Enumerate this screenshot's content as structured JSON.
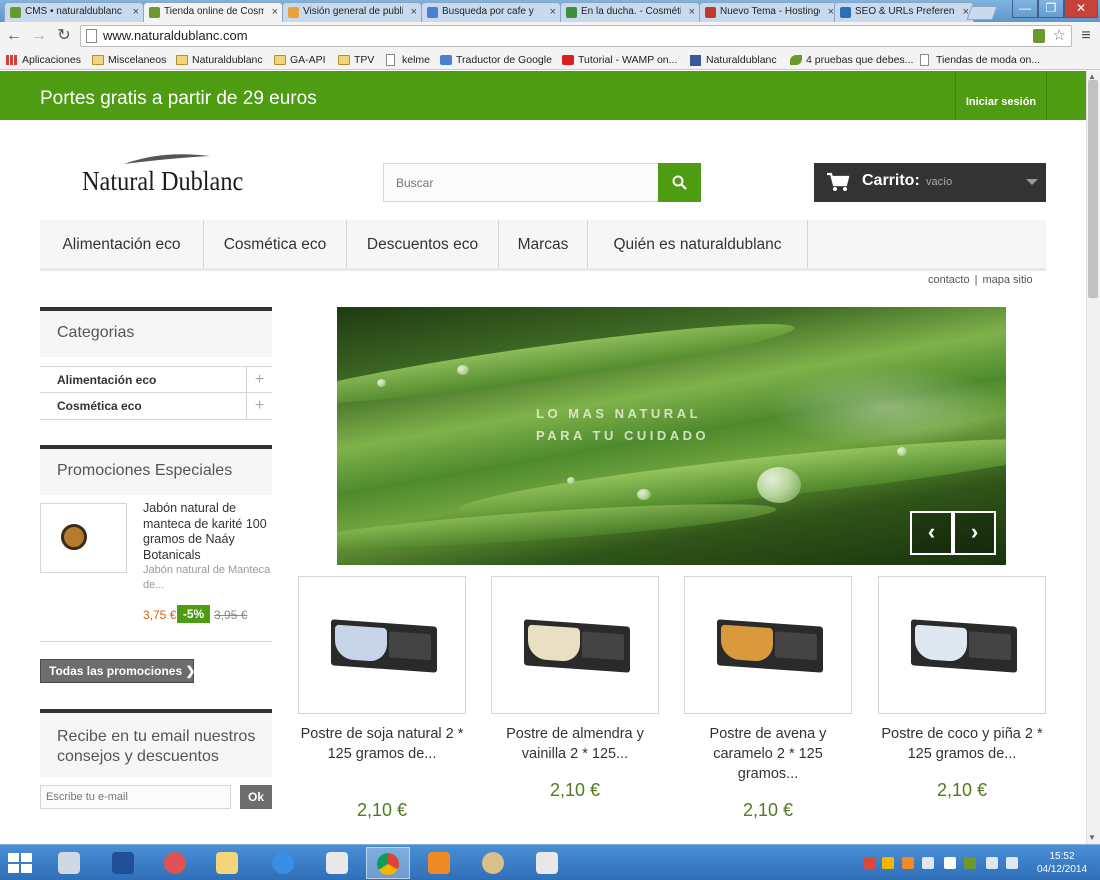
{
  "browser": {
    "tabs": [
      {
        "title": "CMS • naturaldublanc",
        "favicon_color": "#6a9a2e",
        "active": false
      },
      {
        "title": "Tienda online de Cosmética",
        "favicon_color": "#6a9a2e",
        "active": true
      },
      {
        "title": "Visión general de publicidad",
        "favicon_color": "#e8a33d",
        "active": false
      },
      {
        "title": "Busqueda por cafe y",
        "favicon_color": "#4a7fd4",
        "active": false
      },
      {
        "title": "En la ducha. - Cosmética",
        "favicon_color": "#3f8f3f",
        "active": false
      },
      {
        "title": "Nuevo Tema - Hostinger",
        "favicon_color": "#c0392b",
        "active": false
      },
      {
        "title": "SEO & URLs Preferencias",
        "favicon_color": "#2a6fb8",
        "active": false
      }
    ],
    "close_glyph": "×",
    "url": "www.naturaldublanc.com",
    "nav": {
      "back": "←",
      "forward": "→",
      "reload": "↻",
      "menu": "≡",
      "star": "☆"
    },
    "window_controls": {
      "minimize": "—",
      "maximize": "❐",
      "close": "✕"
    },
    "bookmarks": [
      {
        "label": "Aplicaciones",
        "icon": "apps-icon"
      },
      {
        "label": "Miscelaneos",
        "icon": "folder-icon"
      },
      {
        "label": "Naturaldublanc",
        "icon": "folder-icon"
      },
      {
        "label": "GA-API",
        "icon": "folder-icon"
      },
      {
        "label": "TPV",
        "icon": "folder-icon"
      },
      {
        "label": "kelme",
        "icon": "page-icon"
      },
      {
        "label": "Traductor de Google",
        "icon": "translate-icon"
      },
      {
        "label": "Tutorial - WAMP on...",
        "icon": "youtube-icon"
      },
      {
        "label": "Naturaldublanc",
        "icon": "facebook-icon"
      },
      {
        "label": "4 pruebas que debes...",
        "icon": "leaf-icon"
      },
      {
        "label": "Tiendas de moda on...",
        "icon": "page-icon"
      }
    ]
  },
  "site": {
    "promo_bar": "Portes gratis a partir de 29 euros",
    "login": "Iniciar sesión",
    "logo": "Natural Dublanc",
    "search_placeholder": "Buscar",
    "cart": {
      "label": "Carrito:",
      "status": "vacío"
    },
    "nav": [
      "Alimentación eco",
      "Cosmética eco",
      "Descuentos eco",
      "Marcas",
      "Quién es naturaldublanc"
    ],
    "top_links": {
      "contact": "contacto",
      "separator": "|",
      "sitemap": "mapa sitio"
    },
    "categories": {
      "title": "Categorias",
      "items": [
        "Alimentación eco",
        "Cosmética eco"
      ],
      "expand_glyph": "+"
    },
    "specials": {
      "title": "Promociones Especiales",
      "product_name": "Jabón natural de manteca de karité 100 gramos de Naáy Botanicals",
      "product_desc": "Jabón natural de Manteca de...",
      "price": "3,75 €",
      "discount": "-5%",
      "old_price": "3,95 €",
      "all_button": "Todas las promociones ❯"
    },
    "newsletter": {
      "title": "Recibe en tu email nuestros consejos y descuentos",
      "placeholder": "Escribe tu e-mail",
      "button": "Ok"
    },
    "slider": {
      "line1": "LO MAS NATURAL",
      "line2": "PARA TU CUIDADO",
      "prev": "‹",
      "next": "›"
    },
    "products": [
      {
        "name": "Postre de soja natural 2 * 125 gramos de...",
        "price": "2,10 €",
        "cup_color": "#c8d4e8",
        "label_text": "Soja"
      },
      {
        "name": "Postre de almendra y vainilla 2 * 125...",
        "price": "2,10 €",
        "cup_color": "#e9dfc2",
        "label_text": "Almendra"
      },
      {
        "name": "Postre de avena y caramelo 2 * 125 gramos...",
        "price": "2,10 €",
        "cup_color": "#d89a3c",
        "label_text": "Avena"
      },
      {
        "name": "Postre de coco y piña 2 * 125 gramos de...",
        "price": "2,10 €",
        "cup_color": "#dfe8f0",
        "label_text": "Coco"
      }
    ]
  },
  "taskbar": {
    "time": "15:52",
    "date": "04/12/2014",
    "apps": [
      "file-manager-icon",
      "powershell-icon",
      "paint-icon",
      "folder-icon",
      "internet-explorer-icon",
      "rocket-icon",
      "chrome-icon",
      "outlook-icon",
      "palette-icon",
      "rocket-icon"
    ]
  },
  "colors": {
    "brand_green": "#4e9c12",
    "price_green": "#4e7c1f",
    "sale_orange": "#e05d0e"
  }
}
